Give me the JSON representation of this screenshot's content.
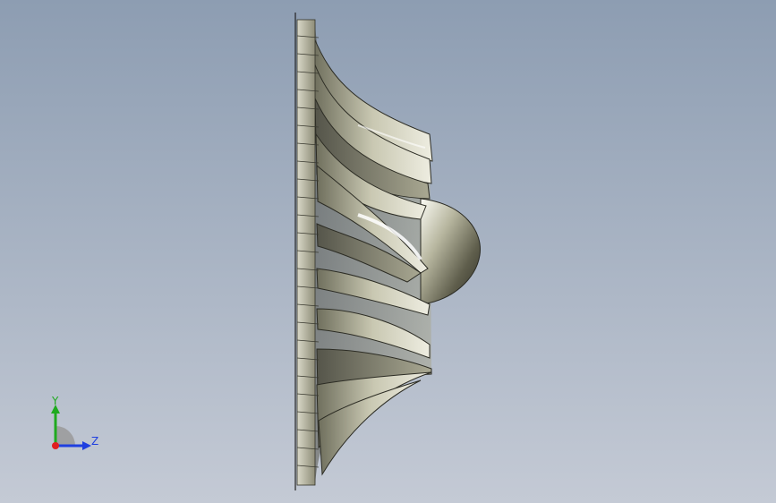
{
  "viewport": {
    "background_top": "#8d9db2",
    "background_bottom": "#c4cad5",
    "model": "turbine-impeller"
  },
  "triad": {
    "y_label": "Y",
    "z_label": "Z",
    "y_color": "#1faa1f",
    "z_color": "#1f3fe0",
    "x_color": "#e01f1f"
  }
}
